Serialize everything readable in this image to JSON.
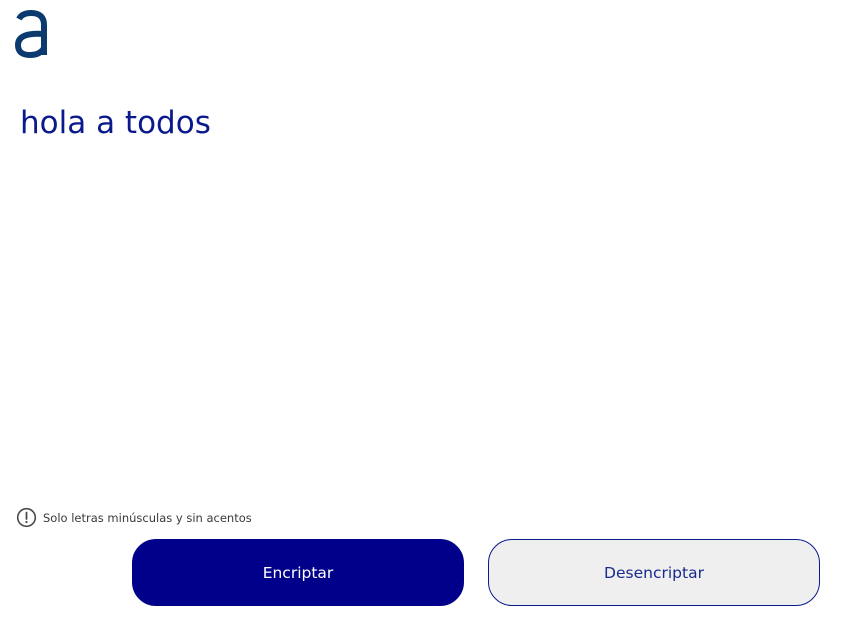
{
  "logo": {
    "icon": "letter-a-logo",
    "color": "#0a3a6e"
  },
  "input": {
    "value": "hola a todos"
  },
  "notice": {
    "icon": "exclamation-circle-icon",
    "text": "Solo letras minúsculas y sin acentos"
  },
  "buttons": {
    "encrypt_label": "Encriptar",
    "decrypt_label": "Desencriptar"
  },
  "colors": {
    "primary": "#00008b",
    "text": "#0a1a8c",
    "secondary_bg": "#efeff0"
  }
}
